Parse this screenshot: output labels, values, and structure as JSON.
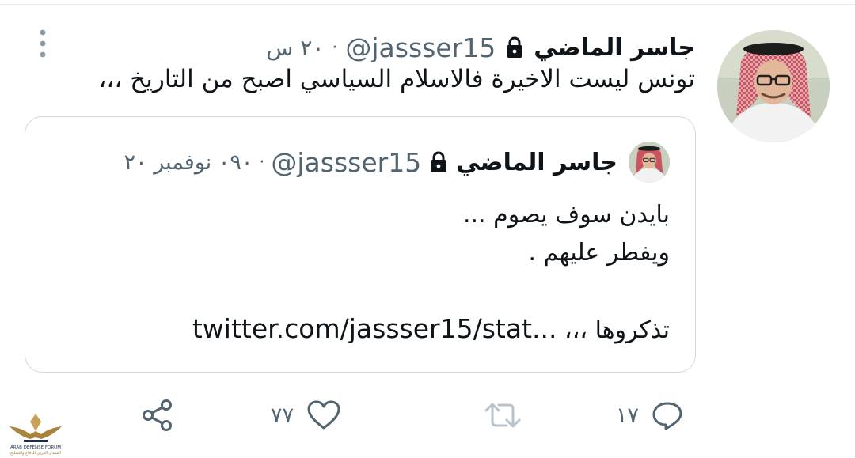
{
  "tweet": {
    "author_name": "جاسر الماضي",
    "handle": "@jassser15",
    "time": "٢٠ س",
    "text": "تونس ليست الاخيرة فالاسلام السياسي اصبح من التاريخ ،،،",
    "quote": {
      "author_name": "جاسر الماضي",
      "handle": "@jassser15",
      "time": "٠٩٠ نوفمبر ٢٠",
      "lines": [
        "بايدن سوف يصوم ...",
        "ويفطر عليهم ."
      ],
      "last_line_prefix": "تذكروها ،،،",
      "url": "twitter.com/jassser15/stat..."
    },
    "actions": {
      "reply_count": "١٧",
      "like_count": "٧٧"
    }
  },
  "icons": {
    "more": "more-vertical-icon",
    "lock": "lock-icon",
    "reply": "reply-icon",
    "retweet": "retweet-icon",
    "like": "heart-icon",
    "share": "share-icon"
  },
  "watermark": {
    "line1": "ARAB DEFENSE FORUM",
    "line2": "المنتدى العربي للدفاع والتسليح"
  },
  "colors": {
    "text": "#0f1419",
    "secondary": "#536471",
    "border": "#cfd9de"
  }
}
